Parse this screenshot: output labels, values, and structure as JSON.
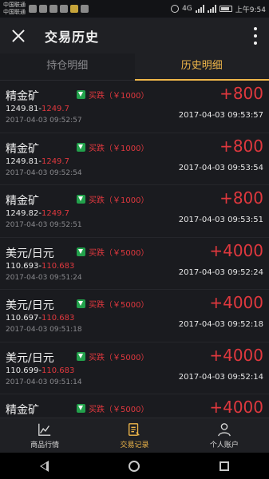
{
  "status_bar": {
    "carrier_1": "中国联通",
    "carrier_2": "中国联通",
    "network": "4G",
    "time": "上午9:54"
  },
  "header": {
    "title": "交易历史"
  },
  "tabs": [
    {
      "label": "持仓明细",
      "active": false
    },
    {
      "label": "历史明细",
      "active": true
    }
  ],
  "trades": [
    {
      "name": "精金矿",
      "direction": "买跌（￥1000）",
      "amount": "+800",
      "open_price": "1249.81",
      "close_price": "1249.7",
      "open_time": "2017-04-03 09:52:57",
      "close_time": "2017-04-03 09:53:57"
    },
    {
      "name": "精金矿",
      "direction": "买跌（￥1000）",
      "amount": "+800",
      "open_price": "1249.81",
      "close_price": "1249.7",
      "open_time": "2017-04-03 09:52:54",
      "close_time": "2017-04-03 09:53:54"
    },
    {
      "name": "精金矿",
      "direction": "买跌（￥1000）",
      "amount": "+800",
      "open_price": "1249.82",
      "close_price": "1249.7",
      "open_time": "2017-04-03 09:52:51",
      "close_time": "2017-04-03 09:53:51"
    },
    {
      "name": "美元/日元",
      "direction": "买跌（￥5000）",
      "amount": "+4000",
      "open_price": "110.693",
      "close_price": "110.683",
      "open_time": "2017-04-03 09:51:24",
      "close_time": "2017-04-03 09:52:24"
    },
    {
      "name": "美元/日元",
      "direction": "买跌（￥5000）",
      "amount": "+4000",
      "open_price": "110.697",
      "close_price": "110.683",
      "open_time": "2017-04-03 09:51:18",
      "close_time": "2017-04-03 09:52:18"
    },
    {
      "name": "美元/日元",
      "direction": "买跌（￥5000）",
      "amount": "+4000",
      "open_price": "110.699",
      "close_price": "110.683",
      "open_time": "2017-04-03 09:51:14",
      "close_time": "2017-04-03 09:52:14"
    },
    {
      "name": "精金矿",
      "direction": "买跌（￥5000）",
      "amount": "+4000",
      "open_price": "",
      "close_price": "",
      "open_time": "",
      "close_time": ""
    }
  ],
  "bottom_nav": [
    {
      "label": "商品行情",
      "icon": "chart-icon",
      "active": false
    },
    {
      "label": "交易记录",
      "icon": "document-icon",
      "active": true
    },
    {
      "label": "个人账户",
      "icon": "user-icon",
      "active": false
    }
  ],
  "colors": {
    "accent": "#f0b74a",
    "loss_red": "#e0383e",
    "down_green": "#22a14b"
  }
}
